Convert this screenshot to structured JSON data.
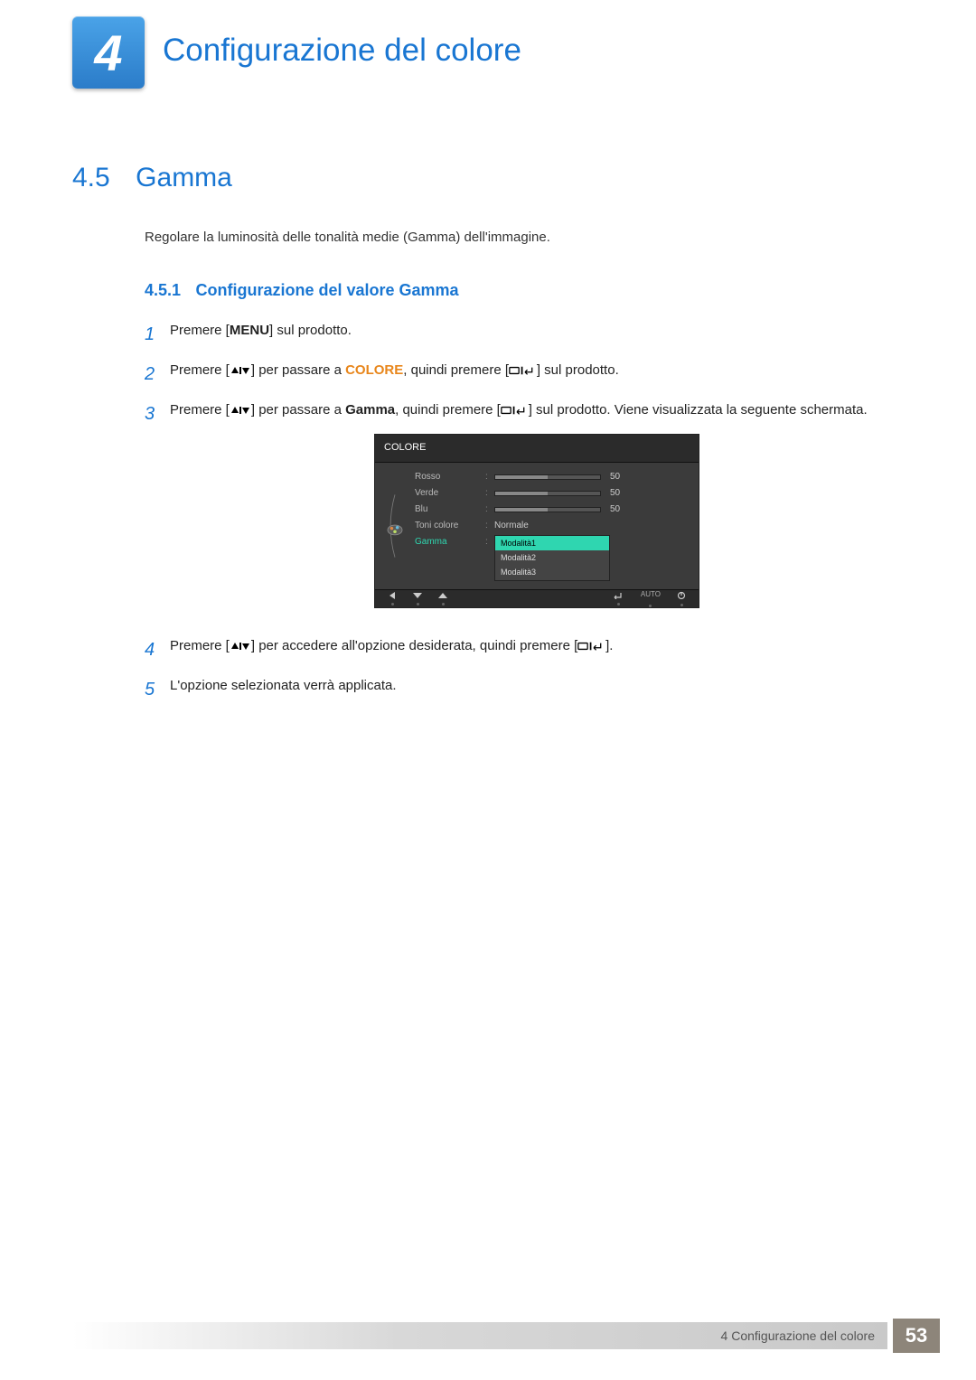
{
  "chapter": {
    "number": "4",
    "title": "Configurazione del colore"
  },
  "section": {
    "number": "4.5",
    "title": "Gamma",
    "intro": "Regolare la luminosità delle tonalità medie (Gamma) dell'immagine."
  },
  "subsection": {
    "number": "4.5.1",
    "title": "Configurazione del valore Gamma"
  },
  "labels": {
    "menu": "MENU",
    "colore": "COLORE",
    "gamma": "Gamma"
  },
  "steps": {
    "s1": {
      "num": "1",
      "a": "Premere [",
      "b": "] sul prodotto."
    },
    "s2": {
      "num": "2",
      "a": "Premere [",
      "b": "] per passare a ",
      "c": ", quindi premere [",
      "d": "] sul prodotto."
    },
    "s3": {
      "num": "3",
      "a": "Premere [",
      "b": "] per passare a ",
      "c": ", quindi premere [",
      "d": "] sul prodotto. Viene visualizzata la seguente schermata."
    },
    "s4": {
      "num": "4",
      "a": "Premere [",
      "b": "] per accedere all'opzione desiderata, quindi premere [",
      "c": "]."
    },
    "s5": {
      "num": "5",
      "a": "L'opzione selezionata verrà applicata."
    }
  },
  "osd": {
    "header": "COLORE",
    "rows": {
      "rosso": {
        "label": "Rosso",
        "value": "50"
      },
      "verde": {
        "label": "Verde",
        "value": "50"
      },
      "blu": {
        "label": "Blu",
        "value": "50"
      },
      "toni": {
        "label": "Toni colore",
        "text": "Normale"
      },
      "gamma": {
        "label": "Gamma"
      }
    },
    "gamma_options": [
      "Modalità1",
      "Modalità2",
      "Modalità3"
    ],
    "footer_auto": "AUTO"
  },
  "footer": {
    "text": "4  Configurazione del colore",
    "page": "53"
  }
}
